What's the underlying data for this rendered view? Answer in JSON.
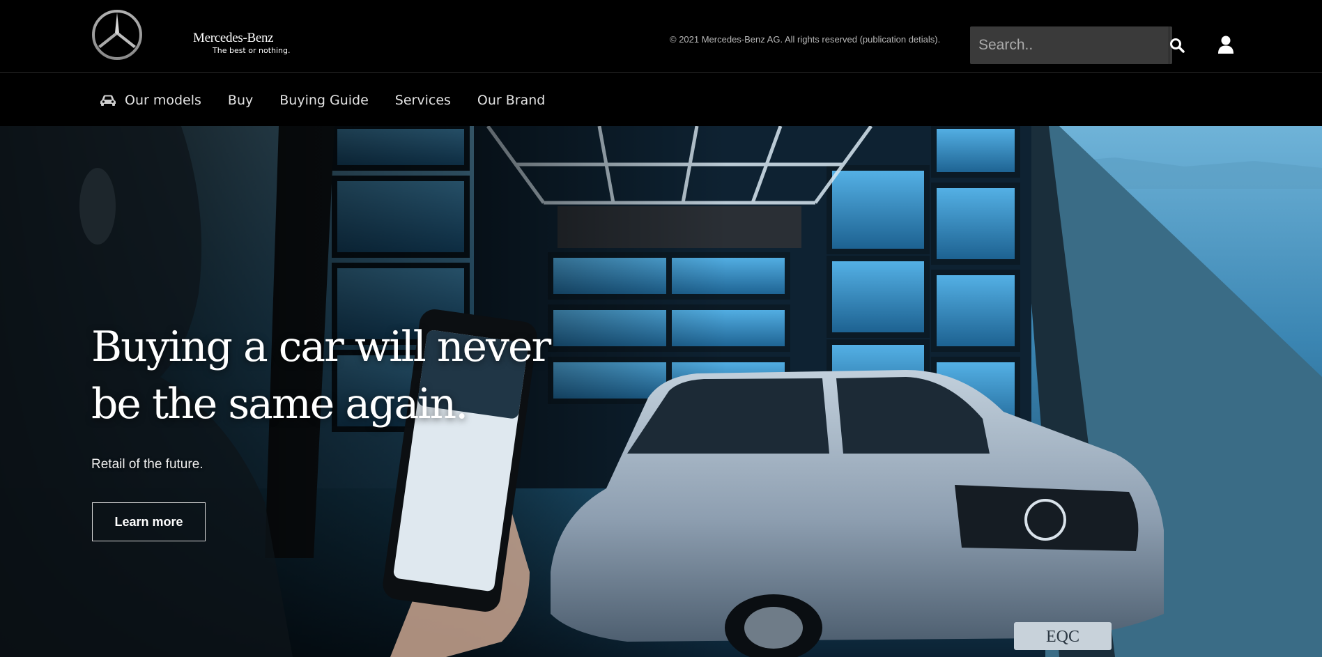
{
  "header": {
    "logo_icon": "mercedes-star-icon",
    "brand_name": "Mercedes-Benz",
    "tagline": "The best or nothing.",
    "copyright": "© 2021 Mercedes-Benz AG. All rights reserved (publication detials).",
    "search": {
      "placeholder": "Search..",
      "value": "",
      "icon": "search-icon"
    },
    "user_icon": "user-icon"
  },
  "nav": {
    "items": [
      {
        "label": "Our models",
        "icon": "car-icon"
      },
      {
        "label": "Buy"
      },
      {
        "label": "Buying Guide"
      },
      {
        "label": "Services"
      },
      {
        "label": "Our Brand"
      }
    ]
  },
  "hero": {
    "title": "Buying a car will never be the same again.",
    "subtitle": "Retail of the future.",
    "cta_label": "Learn more",
    "plate": "EQC",
    "colors": {
      "sky": "#2c6f94",
      "deep": "#0e2638",
      "car": "#8d9eb0"
    }
  }
}
